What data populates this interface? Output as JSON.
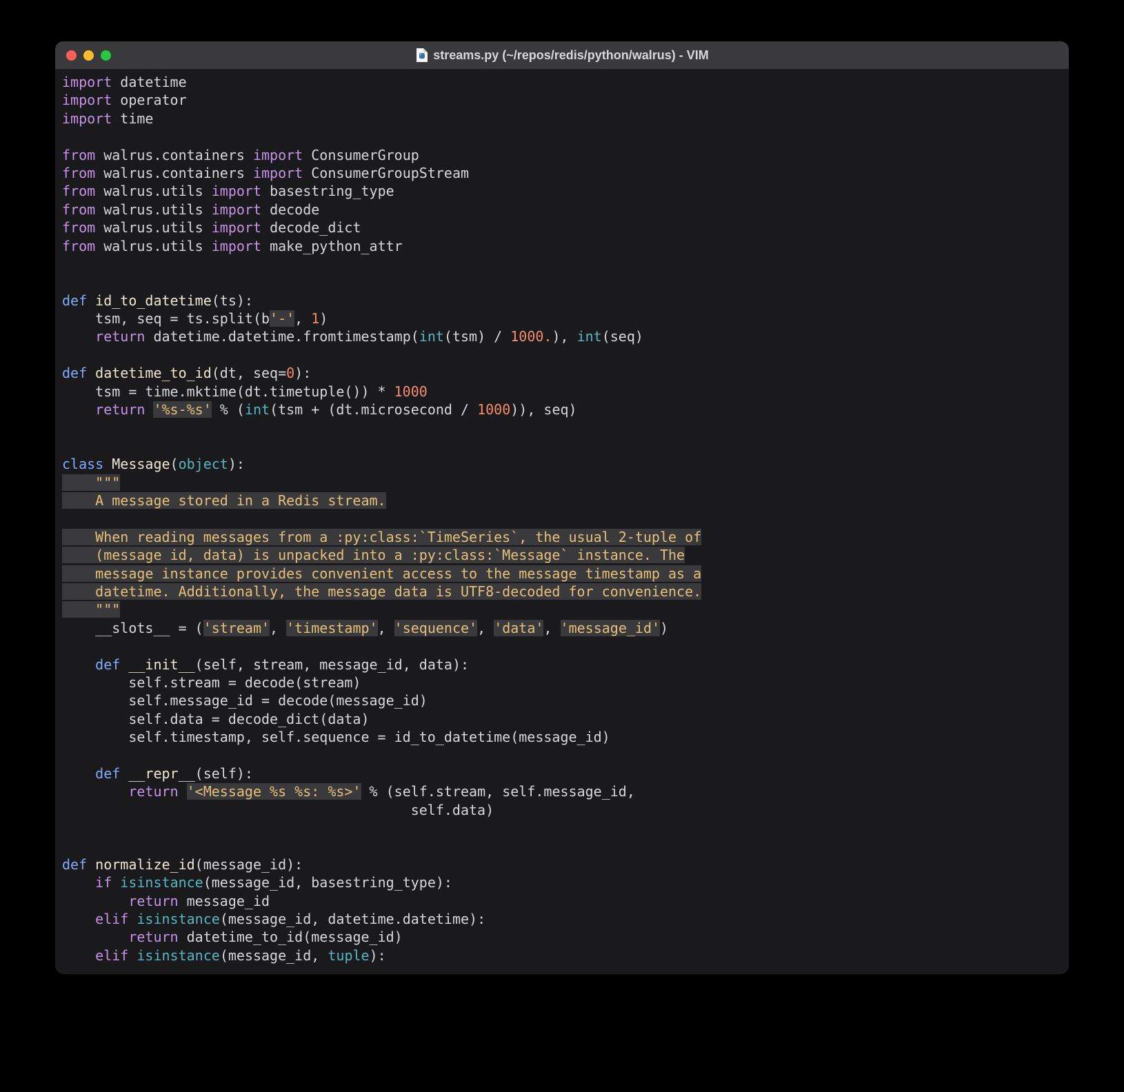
{
  "window": {
    "title": "streams.py (~/repos/redis/python/walrus) - VIM",
    "file_icon_name": "python-file-icon"
  },
  "code": {
    "lines": [
      {
        "tokens": [
          {
            "t": "import ",
            "c": "kw-import"
          },
          {
            "t": "datetime",
            "c": "ident"
          }
        ]
      },
      {
        "tokens": [
          {
            "t": "import ",
            "c": "kw-import"
          },
          {
            "t": "operator",
            "c": "ident"
          }
        ]
      },
      {
        "tokens": [
          {
            "t": "import ",
            "c": "kw-import"
          },
          {
            "t": "time",
            "c": "ident"
          }
        ]
      },
      {
        "tokens": [
          {
            "t": " ",
            "c": ""
          }
        ]
      },
      {
        "tokens": [
          {
            "t": "from ",
            "c": "kw-from"
          },
          {
            "t": "walrus.containers ",
            "c": "ident"
          },
          {
            "t": "import ",
            "c": "kw-import"
          },
          {
            "t": "ConsumerGroup",
            "c": "ident"
          }
        ]
      },
      {
        "tokens": [
          {
            "t": "from ",
            "c": "kw-from"
          },
          {
            "t": "walrus.containers ",
            "c": "ident"
          },
          {
            "t": "import ",
            "c": "kw-import"
          },
          {
            "t": "ConsumerGroupStream",
            "c": "ident"
          }
        ]
      },
      {
        "tokens": [
          {
            "t": "from ",
            "c": "kw-from"
          },
          {
            "t": "walrus.utils ",
            "c": "ident"
          },
          {
            "t": "import ",
            "c": "kw-import"
          },
          {
            "t": "basestring_type",
            "c": "ident"
          }
        ]
      },
      {
        "tokens": [
          {
            "t": "from ",
            "c": "kw-from"
          },
          {
            "t": "walrus.utils ",
            "c": "ident"
          },
          {
            "t": "import ",
            "c": "kw-import"
          },
          {
            "t": "decode",
            "c": "ident"
          }
        ]
      },
      {
        "tokens": [
          {
            "t": "from ",
            "c": "kw-from"
          },
          {
            "t": "walrus.utils ",
            "c": "ident"
          },
          {
            "t": "import ",
            "c": "kw-import"
          },
          {
            "t": "decode_dict",
            "c": "ident"
          }
        ]
      },
      {
        "tokens": [
          {
            "t": "from ",
            "c": "kw-from"
          },
          {
            "t": "walrus.utils ",
            "c": "ident"
          },
          {
            "t": "import ",
            "c": "kw-import"
          },
          {
            "t": "make_python_attr",
            "c": "ident"
          }
        ]
      },
      {
        "tokens": [
          {
            "t": " ",
            "c": ""
          }
        ]
      },
      {
        "tokens": [
          {
            "t": " ",
            "c": ""
          }
        ]
      },
      {
        "tokens": [
          {
            "t": "def ",
            "c": "kw-def"
          },
          {
            "t": "id_to_datetime",
            "c": "fn-name"
          },
          {
            "t": "(ts):",
            "c": "punct"
          }
        ]
      },
      {
        "tokens": [
          {
            "t": "    tsm, seq = ts.split(b",
            "c": "ident"
          },
          {
            "t": "'-'",
            "c": "str"
          },
          {
            "t": ", ",
            "c": "punct"
          },
          {
            "t": "1",
            "c": "num"
          },
          {
            "t": ")",
            "c": "punct"
          }
        ]
      },
      {
        "tokens": [
          {
            "t": "    ",
            "c": ""
          },
          {
            "t": "return ",
            "c": "kw-return"
          },
          {
            "t": "datetime.datetime.fromtimestamp(",
            "c": "ident"
          },
          {
            "t": "int",
            "c": "builtin"
          },
          {
            "t": "(tsm) / ",
            "c": "ident"
          },
          {
            "t": "1000.",
            "c": "num"
          },
          {
            "t": "), ",
            "c": "punct"
          },
          {
            "t": "int",
            "c": "builtin"
          },
          {
            "t": "(seq)",
            "c": "punct"
          }
        ]
      },
      {
        "tokens": [
          {
            "t": " ",
            "c": ""
          }
        ]
      },
      {
        "tokens": [
          {
            "t": "def ",
            "c": "kw-def"
          },
          {
            "t": "datetime_to_id",
            "c": "fn-name"
          },
          {
            "t": "(dt, seq=",
            "c": "punct"
          },
          {
            "t": "0",
            "c": "num"
          },
          {
            "t": "):",
            "c": "punct"
          }
        ]
      },
      {
        "tokens": [
          {
            "t": "    tsm = time.mktime(dt.timetuple()) * ",
            "c": "ident"
          },
          {
            "t": "1000",
            "c": "num"
          }
        ]
      },
      {
        "tokens": [
          {
            "t": "    ",
            "c": ""
          },
          {
            "t": "return ",
            "c": "kw-return"
          },
          {
            "t": "'%s-%s'",
            "c": "str"
          },
          {
            "t": " % (",
            "c": "ident"
          },
          {
            "t": "int",
            "c": "builtin"
          },
          {
            "t": "(tsm + (dt.microsecond / ",
            "c": "ident"
          },
          {
            "t": "1000",
            "c": "num"
          },
          {
            "t": ")), seq)",
            "c": "ident"
          }
        ]
      },
      {
        "tokens": [
          {
            "t": " ",
            "c": ""
          }
        ]
      },
      {
        "tokens": [
          {
            "t": " ",
            "c": ""
          }
        ]
      },
      {
        "tokens": [
          {
            "t": "class ",
            "c": "kw-class"
          },
          {
            "t": "Message",
            "c": "cls-name"
          },
          {
            "t": "(",
            "c": "punct"
          },
          {
            "t": "object",
            "c": "builtin"
          },
          {
            "t": "):",
            "c": "punct"
          }
        ]
      },
      {
        "tokens": [
          {
            "t": "    ",
            "c": "doc"
          },
          {
            "t": "\"\"\"",
            "c": "doc"
          }
        ]
      },
      {
        "tokens": [
          {
            "t": "    A message stored in a Redis stream.",
            "c": "doc"
          }
        ]
      },
      {
        "tokens": [
          {
            "t": " ",
            "c": ""
          }
        ]
      },
      {
        "tokens": [
          {
            "t": "    When reading messages from a :py:class:`TimeSeries`, the usual 2-tuple of",
            "c": "doc"
          }
        ]
      },
      {
        "tokens": [
          {
            "t": "    (message id, data) is unpacked into a :py:class:`Message` instance. The",
            "c": "doc"
          }
        ]
      },
      {
        "tokens": [
          {
            "t": "    message instance provides convenient access to the message timestamp as a",
            "c": "doc"
          }
        ]
      },
      {
        "tokens": [
          {
            "t": "    datetime. Additionally, the message data is UTF8-decoded for convenience.",
            "c": "doc"
          }
        ]
      },
      {
        "tokens": [
          {
            "t": "    \"\"\"",
            "c": "doc"
          }
        ]
      },
      {
        "tokens": [
          {
            "t": "    __slots__ = (",
            "c": "ident"
          },
          {
            "t": "'stream'",
            "c": "str"
          },
          {
            "t": ", ",
            "c": "punct"
          },
          {
            "t": "'timestamp'",
            "c": "str"
          },
          {
            "t": ", ",
            "c": "punct"
          },
          {
            "t": "'sequence'",
            "c": "str"
          },
          {
            "t": ", ",
            "c": "punct"
          },
          {
            "t": "'data'",
            "c": "str"
          },
          {
            "t": ", ",
            "c": "punct"
          },
          {
            "t": "'message_id'",
            "c": "str"
          },
          {
            "t": ")",
            "c": "punct"
          }
        ]
      },
      {
        "tokens": [
          {
            "t": " ",
            "c": ""
          }
        ]
      },
      {
        "tokens": [
          {
            "t": "    ",
            "c": ""
          },
          {
            "t": "def ",
            "c": "kw-def"
          },
          {
            "t": "__init__",
            "c": "fn-name"
          },
          {
            "t": "(self, stream, message_id, data):",
            "c": "punct"
          }
        ]
      },
      {
        "tokens": [
          {
            "t": "        self.stream = decode(stream)",
            "c": "ident"
          }
        ]
      },
      {
        "tokens": [
          {
            "t": "        self.message_id = decode(message_id)",
            "c": "ident"
          }
        ]
      },
      {
        "tokens": [
          {
            "t": "        self.data = decode_dict(data)",
            "c": "ident"
          }
        ]
      },
      {
        "tokens": [
          {
            "t": "        self.timestamp, self.sequence = id_to_datetime(message_id)",
            "c": "ident"
          }
        ]
      },
      {
        "tokens": [
          {
            "t": " ",
            "c": ""
          }
        ]
      },
      {
        "tokens": [
          {
            "t": "    ",
            "c": ""
          },
          {
            "t": "def ",
            "c": "kw-def"
          },
          {
            "t": "__repr__",
            "c": "fn-name"
          },
          {
            "t": "(self):",
            "c": "punct"
          }
        ]
      },
      {
        "tokens": [
          {
            "t": "        ",
            "c": ""
          },
          {
            "t": "return ",
            "c": "kw-return"
          },
          {
            "t": "'<Message %s %s: %s>'",
            "c": "str"
          },
          {
            "t": " % (self.stream, self.message_id,",
            "c": "ident"
          }
        ]
      },
      {
        "tokens": [
          {
            "t": "                                          self.data)",
            "c": "ident"
          }
        ]
      },
      {
        "tokens": [
          {
            "t": " ",
            "c": ""
          }
        ]
      },
      {
        "tokens": [
          {
            "t": " ",
            "c": ""
          }
        ]
      },
      {
        "tokens": [
          {
            "t": "def ",
            "c": "kw-def"
          },
          {
            "t": "normalize_id",
            "c": "fn-name"
          },
          {
            "t": "(message_id):",
            "c": "punct"
          }
        ]
      },
      {
        "tokens": [
          {
            "t": "    ",
            "c": ""
          },
          {
            "t": "if ",
            "c": "kw-if"
          },
          {
            "t": "isinstance",
            "c": "builtin"
          },
          {
            "t": "(message_id, basestring_type):",
            "c": "ident"
          }
        ]
      },
      {
        "tokens": [
          {
            "t": "        ",
            "c": ""
          },
          {
            "t": "return ",
            "c": "kw-return"
          },
          {
            "t": "message_id",
            "c": "ident"
          }
        ]
      },
      {
        "tokens": [
          {
            "t": "    ",
            "c": ""
          },
          {
            "t": "elif ",
            "c": "kw-elif"
          },
          {
            "t": "isinstance",
            "c": "builtin"
          },
          {
            "t": "(message_id, datetime.datetime):",
            "c": "ident"
          }
        ]
      },
      {
        "tokens": [
          {
            "t": "        ",
            "c": ""
          },
          {
            "t": "return ",
            "c": "kw-return"
          },
          {
            "t": "datetime_to_id(message_id)",
            "c": "ident"
          }
        ]
      },
      {
        "tokens": [
          {
            "t": "    ",
            "c": ""
          },
          {
            "t": "elif ",
            "c": "kw-elif"
          },
          {
            "t": "isinstance",
            "c": "builtin"
          },
          {
            "t": "(message_id, ",
            "c": "ident"
          },
          {
            "t": "tuple",
            "c": "builtin"
          },
          {
            "t": "):",
            "c": "punct"
          }
        ]
      }
    ]
  }
}
